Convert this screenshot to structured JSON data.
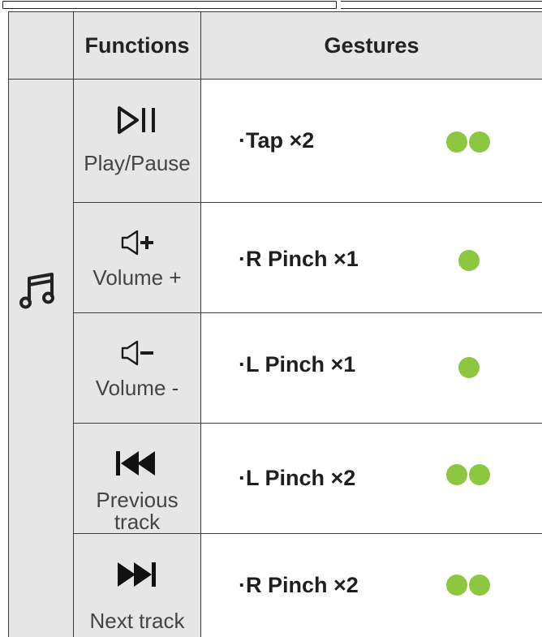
{
  "header": {
    "functions": "Functions",
    "gestures": "Gestures"
  },
  "category_icon": "music-note-icon",
  "accent_color": "#8dc63f",
  "rows": [
    {
      "icon": "play-pause-icon",
      "label": "Play/Pause",
      "gesture": "·Tap ×2",
      "dots": 2
    },
    {
      "icon": "volume-up-icon",
      "label": "Volume +",
      "gesture": "·R Pinch ×1",
      "dots": 1
    },
    {
      "icon": "volume-down-icon",
      "label": "Volume -",
      "gesture": "·L Pinch ×1",
      "dots": 1
    },
    {
      "icon": "previous-track-icon",
      "label_lines": [
        "Previous",
        "track"
      ],
      "gesture": "·L Pinch ×2",
      "dots": 2
    },
    {
      "icon": "next-track-icon",
      "label": "Next track",
      "gesture": "·R Pinch ×2",
      "dots": 2
    }
  ]
}
